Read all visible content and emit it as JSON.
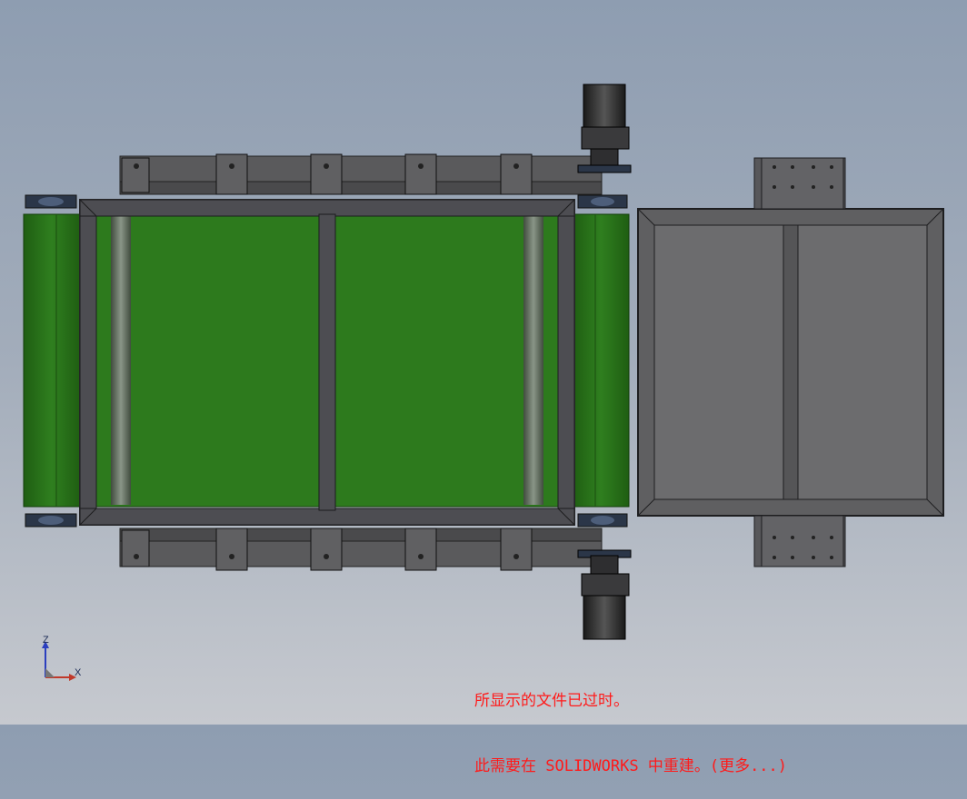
{
  "viewport": {
    "background_top": "#8e9db1",
    "background_bottom": "#c6c9cf"
  },
  "colors": {
    "belt_green": "#2f7a1f",
    "frame_gray": "#6b6b6d",
    "dark_gray": "#3c3c3e",
    "housing_gray": "#5f5f61",
    "notice_red": "#ff1a1a"
  },
  "notice": {
    "line1": "所显示的文件已过时。",
    "line2_prefix": "此需要在 SOLIDWORKS 中重建。",
    "line2_link": "(更多...)"
  },
  "triad": {
    "z_label": "Z",
    "x_label": "X"
  }
}
